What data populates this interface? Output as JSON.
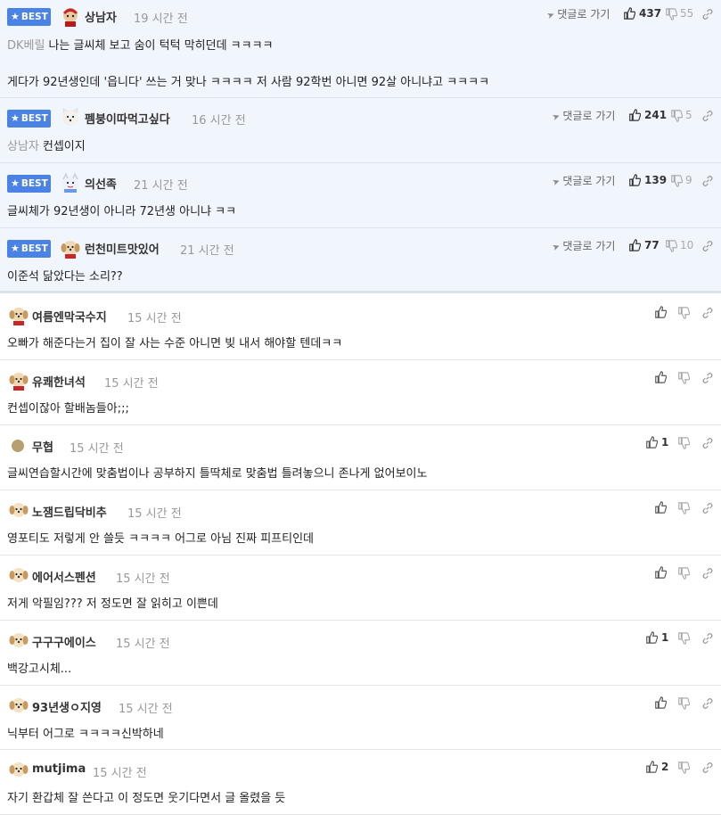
{
  "common": {
    "badge_label": "BEST",
    "reply_label": "댓글로 가기"
  },
  "best": [
    {
      "nick": "상남자",
      "time": "19 시간 전",
      "mention": "DK베릴",
      "text": "나는 글씨체 보고 숨이 턱턱 막히던데 ㅋㅋㅋㅋ",
      "text2": "게다가 92년생인데 '읍니다' 쓰는 거 맞나 ㅋㅋㅋㅋ 저 사람 92학번 아니면 92살 아니냐고 ㅋㅋㅋㅋ",
      "up": "437",
      "down": "55"
    },
    {
      "nick": "펨붕이따먹고싶다",
      "time": "16 시간 전",
      "mention": "상남자",
      "text": "컨셉이지",
      "up": "241",
      "down": "5"
    },
    {
      "nick": "의선족",
      "time": "21 시간 전",
      "mention": "",
      "text": "글씨체가 92년생이 아니라 72년생 아니냐 ㅋㅋ",
      "up": "139",
      "down": "9"
    },
    {
      "nick": "런천미트맛있어",
      "time": "21 시간 전",
      "mention": "",
      "text": "이준석 닮았다는 소리??",
      "up": "77",
      "down": "10"
    }
  ],
  "comments": [
    {
      "nick": "여름엔막국수지",
      "time": "15 시간 전",
      "text": "오빠가 해준다는거 집이 잘 사는 수준 아니면 빚 내서 해야할 텐데ㅋㅋ",
      "up": ""
    },
    {
      "nick": "유쾌한녀석",
      "time": "15 시간 전",
      "text": "컨셉이잖아 할배놈들아;;;",
      "up": ""
    },
    {
      "nick": "무협",
      "time": "15 시간 전",
      "text": "글씨연습할시간에 맞춤법이나 공부하지 틀딱체로 맞춤법 틀려놓으니 존나게 없어보이노",
      "up": "1"
    },
    {
      "nick": "노잼드립닥비추",
      "time": "15 시간 전",
      "text": "영포티도 저렇게 안 쓸듯 ㅋㅋㅋㅋ 어그로 아님 진짜 피프티인데",
      "up": ""
    },
    {
      "nick": "에어서스펜션",
      "time": "15 시간 전",
      "text": "저게 악필임??? 저 정도면 잘 읽히고 이쁜데",
      "up": ""
    },
    {
      "nick": "구구구에이스",
      "time": "15 시간 전",
      "text": "백강고시체...",
      "up": "1"
    },
    {
      "nick": "93년생ㅇ지영",
      "time": "15 시간 전",
      "text": "닉부터 어그로 ㅋㅋㅋㅋ신박하네",
      "up": ""
    },
    {
      "nick": "mutjima",
      "time": "15 시간 전",
      "text": "자기 환갑체 잘 쓴다고 이 정도면 웃기다면서 글 올렸을 듯",
      "up": "2"
    }
  ]
}
